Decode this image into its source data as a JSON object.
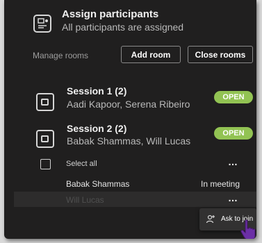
{
  "assign": {
    "title": "Assign participants",
    "subtitle": "All participants are assigned",
    "icon": "assign-participants-icon"
  },
  "manage": {
    "label": "Manage rooms",
    "add_room": "Add room",
    "close_rooms": "Close rooms"
  },
  "rooms": [
    {
      "name": "Session 1 (2)",
      "people": "Aadi Kapoor, Serena Ribeiro",
      "status": "OPEN"
    },
    {
      "name": "Session 2 (2)",
      "people": "Babak Shammas, Will Lucas",
      "status": "OPEN"
    }
  ],
  "selection": {
    "select_all": "Select all",
    "more": "…"
  },
  "participants": [
    {
      "name": "Babak Shammas",
      "status": "In meeting"
    },
    {
      "name": "Will Lucas",
      "status": ""
    }
  ],
  "context_menu": {
    "ask_to_join": "Ask to join",
    "icon": "person-add-icon"
  },
  "colors": {
    "panel": "#201f1f",
    "open_badge": "#92c353",
    "cursor": "#6b2fa6"
  }
}
